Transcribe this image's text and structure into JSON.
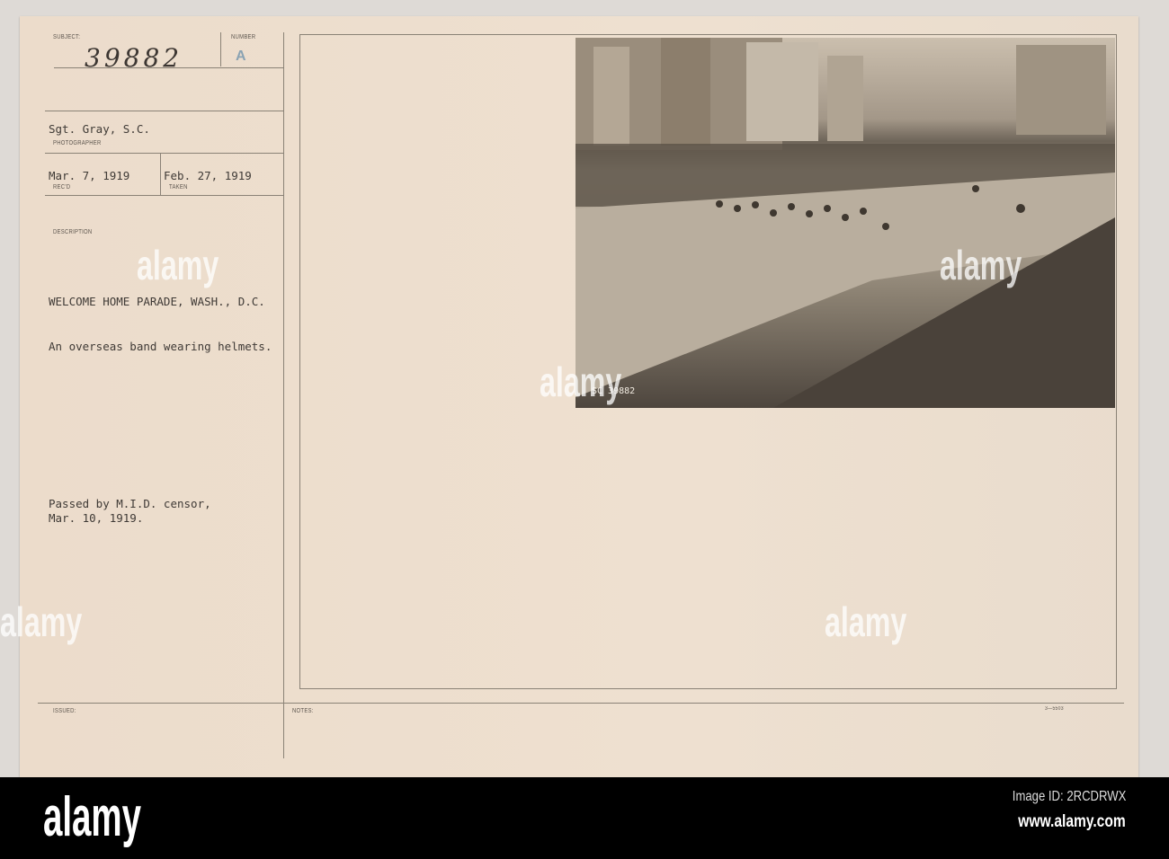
{
  "card": {
    "subject_label": "SUBJECT:",
    "number_label": "NUMBER",
    "subject_number": "39882",
    "number_value": "A",
    "photographer": "Sgt. Gray, S.C.",
    "photographer_label": "PHOTOGRAPHER",
    "received": "Mar. 7, 1919",
    "received_label": "REC'D",
    "taken": "Feb. 27, 1919",
    "taken_label": "TAKEN",
    "description_label": "DESCRIPTION",
    "title": "WELCOME HOME PARADE, WASH., D.C.",
    "description": "An overseas band wearing helmets.",
    "censor_line1": "Passed by M.I.D. censor,",
    "censor_line2": "Mar. 10, 1919.",
    "issued_label": "ISSUED:",
    "notes_label": "NOTES:",
    "form_number": "3—5503",
    "photo_number": "SC 39882"
  },
  "watermark": {
    "text": "alamy"
  },
  "footer": {
    "logo": "alamy",
    "image_id": "Image ID: 2RCDRWX",
    "url": "www.alamy.com"
  }
}
